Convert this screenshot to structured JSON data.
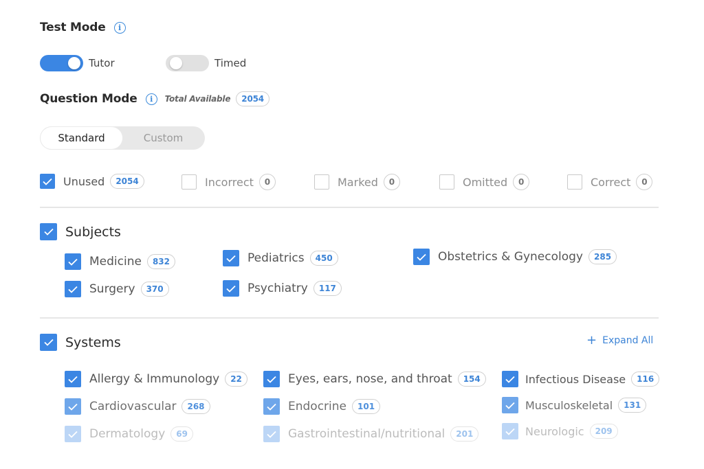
{
  "test_mode": {
    "title": "Test Mode",
    "info_icon": "info-icon",
    "toggles": [
      {
        "label": "Tutor",
        "on": true
      },
      {
        "label": "Timed",
        "on": false
      }
    ]
  },
  "question_mode": {
    "title": "Question Mode",
    "info_icon": "info-icon",
    "total_available_label": "Total Available",
    "total_available_count": "2054",
    "segments": [
      {
        "label": "Standard",
        "active": true
      },
      {
        "label": "Custom",
        "active": false
      }
    ],
    "filters": [
      {
        "label": "Unused",
        "count": "2054",
        "checked": true
      },
      {
        "label": "Incorrect",
        "count": "0",
        "checked": false
      },
      {
        "label": "Marked",
        "count": "0",
        "checked": false
      },
      {
        "label": "Omitted",
        "count": "0",
        "checked": false
      },
      {
        "label": "Correct",
        "count": "0",
        "checked": false
      }
    ]
  },
  "subjects": {
    "title": "Subjects",
    "checked": true,
    "items": [
      {
        "label": "Medicine",
        "count": "832",
        "checked": true
      },
      {
        "label": "Surgery",
        "count": "370",
        "checked": true
      },
      {
        "label": "Pediatrics",
        "count": "450",
        "checked": true
      },
      {
        "label": "Psychiatry",
        "count": "117",
        "checked": true
      },
      {
        "label": "Obstetrics & Gynecology",
        "count": "285",
        "checked": true
      }
    ]
  },
  "systems": {
    "title": "Systems",
    "checked": true,
    "expand_all_label": "Expand All",
    "items": [
      {
        "label": "Allergy & Immunology",
        "count": "22",
        "checked": true
      },
      {
        "label": "Cardiovascular",
        "count": "268",
        "checked": true
      },
      {
        "label": "Dermatology",
        "count": "69",
        "checked": true
      },
      {
        "label": "Eyes, ears, nose, and throat",
        "count": "154",
        "checked": true
      },
      {
        "label": "Endocrine",
        "count": "101",
        "checked": true
      },
      {
        "label": "Gastrointestinal/nutritional",
        "count": "201",
        "checked": true
      },
      {
        "label": "Infectious Disease",
        "count": "116",
        "checked": true
      },
      {
        "label": "Musculoskeletal",
        "count": "131",
        "checked": true
      },
      {
        "label": "Neurologic",
        "count": "209",
        "checked": true
      }
    ]
  },
  "colors": {
    "accent": "#3b86e3",
    "badge_text": "#3d84d6",
    "divider": "#e6e6e6"
  }
}
